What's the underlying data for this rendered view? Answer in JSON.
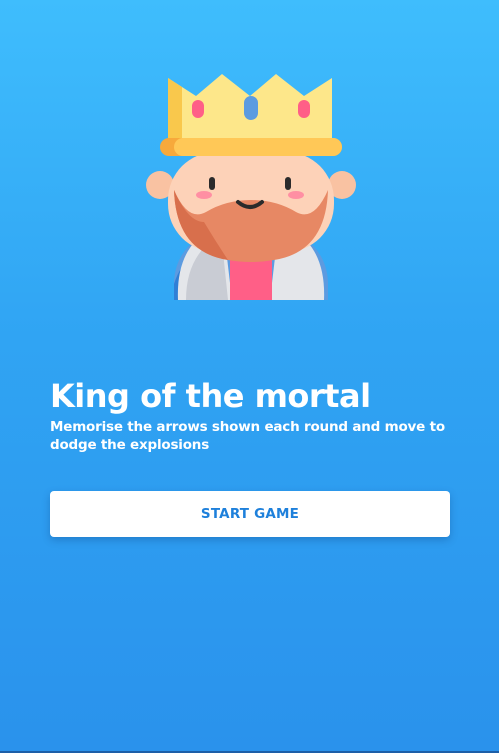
{
  "screen": {
    "mascot_icon": "king-icon",
    "title": "King of the mortal",
    "description": "Memorise the arrows shown each round and move to dodge the explosions",
    "start_button_label": "START GAME"
  },
  "colors": {
    "background_top": "#3fbdfd",
    "background_bottom": "#2a92ec",
    "button_background": "#ffffff",
    "button_text": "#1e80db",
    "title_text": "#ffffff"
  }
}
